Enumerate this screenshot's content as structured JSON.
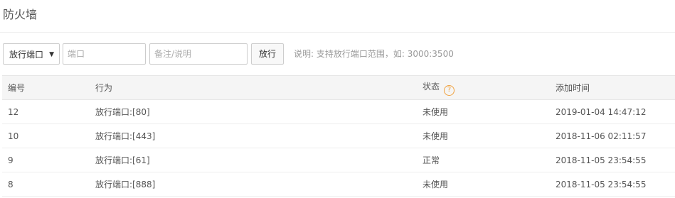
{
  "page": {
    "title": "防火墙"
  },
  "toolbar": {
    "action_select": {
      "value": "放行端口"
    },
    "port_input": {
      "value": "",
      "placeholder": "端口"
    },
    "note_input": {
      "value": "",
      "placeholder": "备注/说明"
    },
    "submit_label": "放行",
    "hint": "说明: 支持放行端口范围，如: 3000:3500"
  },
  "table": {
    "columns": [
      "编号",
      "行为",
      "状态",
      "添加时间"
    ],
    "rows": [
      {
        "id": "12",
        "action": "放行端口:[80]",
        "status": "未使用",
        "time": "2019-01-04 14:47:12"
      },
      {
        "id": "10",
        "action": "放行端口:[443]",
        "status": "未使用",
        "time": "2018-11-06 02:11:57"
      },
      {
        "id": "9",
        "action": "放行端口:[61]",
        "status": "正常",
        "time": "2018-11-05 23:54:55"
      },
      {
        "id": "8",
        "action": "放行端口:[888]",
        "status": "未使用",
        "time": "2018-11-05 23:54:55"
      }
    ]
  },
  "icons": {
    "status_help": "question-circle-icon",
    "select_caret": "caret-down-icon"
  },
  "colors": {
    "help_icon": "#f0a03c",
    "header_bg": "#f5f5f5"
  }
}
